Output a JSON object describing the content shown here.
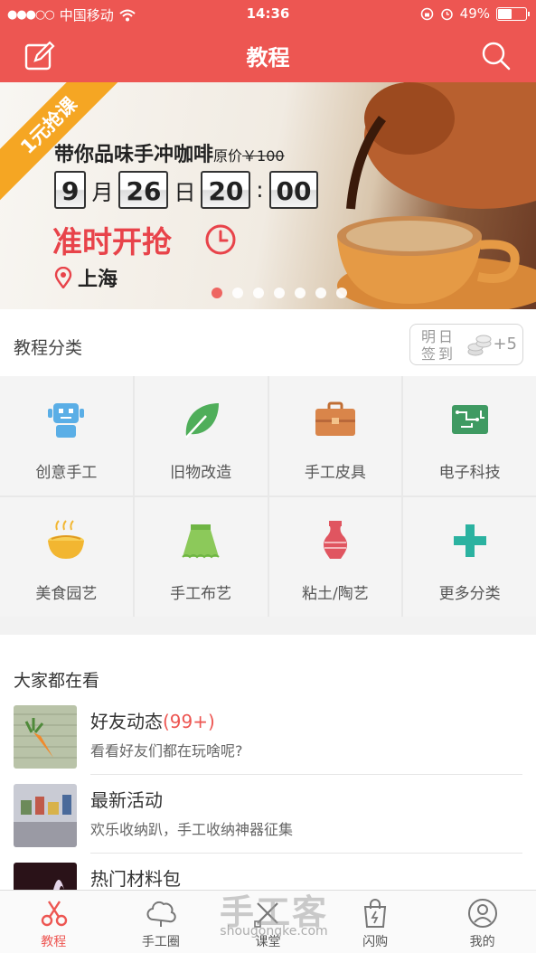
{
  "status_bar": {
    "carrier": "中国移动",
    "time": "14:36",
    "battery": "49%",
    "battery_level": 0.49
  },
  "header": {
    "title": "教程",
    "left_icon": "edit-icon",
    "right_icon": "search-icon"
  },
  "banner": {
    "ribbon": "1元抢课",
    "title": "带你品味手冲咖啡",
    "original_price_label": "原价",
    "original_price": "￥100",
    "countdown": {
      "month": "9",
      "month_unit": "月",
      "day": "26",
      "day_unit": "日",
      "hour": "20",
      "separator": ":",
      "minute": "00"
    },
    "slogan": "准时开抢",
    "city": "上海",
    "slide_count": 7,
    "active_slide": 1
  },
  "categories": {
    "title": "教程分类",
    "checkin": {
      "label": "明日签到",
      "bonus": "+5"
    },
    "items": [
      {
        "label": "创意手工",
        "icon": "robot-icon",
        "color": "#5aaee6"
      },
      {
        "label": "旧物改造",
        "icon": "leaf-icon",
        "color": "#4fae5a"
      },
      {
        "label": "手工皮具",
        "icon": "briefcase-icon",
        "color": "#d9854a"
      },
      {
        "label": "电子科技",
        "icon": "circuit-board-icon",
        "color": "#3f9a62"
      },
      {
        "label": "美食园艺",
        "icon": "noodle-bowl-icon",
        "color": "#f2b631"
      },
      {
        "label": "手工布艺",
        "icon": "skirt-icon",
        "color": "#8cc95a"
      },
      {
        "label": "粘土/陶艺",
        "icon": "vase-icon",
        "color": "#e05560"
      },
      {
        "label": "更多分类",
        "icon": "plus-icon",
        "color": "#2bb2a0"
      }
    ]
  },
  "watching": {
    "title": "大家都在看",
    "items": [
      {
        "title": "好友动态",
        "count": "(99+)",
        "subtitle": "看看好友们都在玩啥呢?"
      },
      {
        "title": "最新活动",
        "count": "",
        "subtitle": "欢乐收纳趴，手工收纳神器征集"
      },
      {
        "title": "热门材料包",
        "count": "",
        "subtitle": ""
      }
    ]
  },
  "tabbar": {
    "items": [
      {
        "label": "教程",
        "icon": "scissors-icon",
        "active": true
      },
      {
        "label": "手工圈",
        "icon": "cloud-flower-icon",
        "active": false
      },
      {
        "label": "课堂",
        "icon": "pencil-ruler-icon",
        "active": false
      },
      {
        "label": "闪购",
        "icon": "shopping-bag-icon",
        "active": false
      },
      {
        "label": "我的",
        "icon": "user-icon",
        "active": false
      }
    ]
  },
  "watermark": {
    "text": "手工客",
    "url": "shougongke.com"
  },
  "colors": {
    "brand": "#ed5652",
    "ribbon": "#f5a623",
    "slogan": "#e8434a"
  }
}
